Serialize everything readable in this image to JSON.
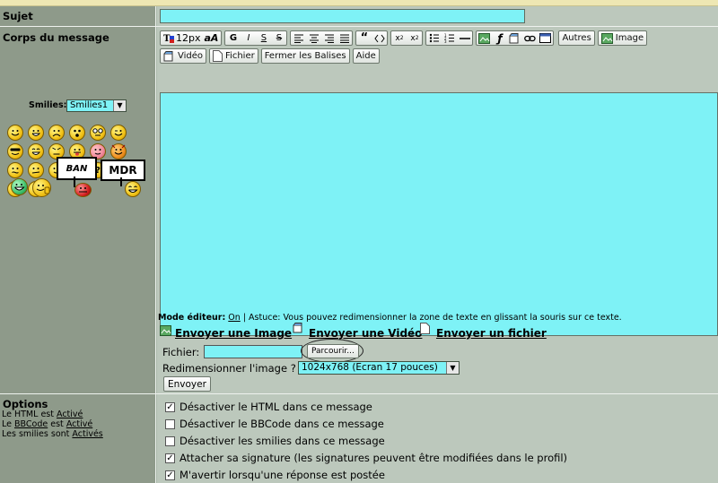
{
  "subject": {
    "label": "Sujet",
    "value": ""
  },
  "body_section": {
    "label": "Corps du message"
  },
  "toolbar": {
    "font_size": "12px",
    "case_icon": "aA",
    "bold": "G",
    "italic": "I",
    "underline": "S",
    "strike": "S",
    "others_label": "Autres",
    "image_label": "Image",
    "video_label": "Vidéo",
    "file_label": "Fichier",
    "close_tags_label": "Fermer les Balises",
    "help_label": "Aide"
  },
  "smilies": {
    "label": "Smilies:",
    "selected": "Smilies1",
    "ban_text": "BAN",
    "mdr_text": "MDR"
  },
  "editor_mode": {
    "label": "Mode éditeur:",
    "state": "On",
    "tip": "| Astuce: Vous pouvez redimensionner la zone de texte en glissant la souris sur ce texte."
  },
  "upload": {
    "send_image": "Envoyer une Image",
    "send_video": "Envoyer une Vidéo",
    "send_file": "Envoyer un fichier",
    "sep": "-",
    "file_label": "Fichier:",
    "browse_label": "Parcourir...",
    "resize_label": "Redimensionner l'image ?",
    "resize_value": "1024x768 (Ecran 17 pouces)",
    "submit_label": "Envoyer"
  },
  "options": {
    "title": "Options",
    "html_prefix": "Le HTML est",
    "html_state": "Activé",
    "bbcode_prefix": "Le",
    "bbcode_link": "BBCode",
    "bbcode_mid": "est",
    "bbcode_state": "Activé",
    "smilies_prefix": "Les smilies sont",
    "smilies_state": "Activés",
    "checks": [
      {
        "label": "Désactiver le HTML dans ce message",
        "checked": true
      },
      {
        "label": "Désactiver le BBCode dans ce message",
        "checked": false
      },
      {
        "label": "Désactiver les smilies dans ce message",
        "checked": false
      },
      {
        "label": "Attacher sa signature (les signatures peuvent être modifiées dans le profil)",
        "checked": true
      },
      {
        "label": "M'avertir lorsqu'une réponse est postée",
        "checked": true
      }
    ]
  },
  "colors": {
    "editor_bg": "#7ef2f6",
    "panel_left": "#8e9a8a",
    "panel_right": "#bcc8bc"
  }
}
